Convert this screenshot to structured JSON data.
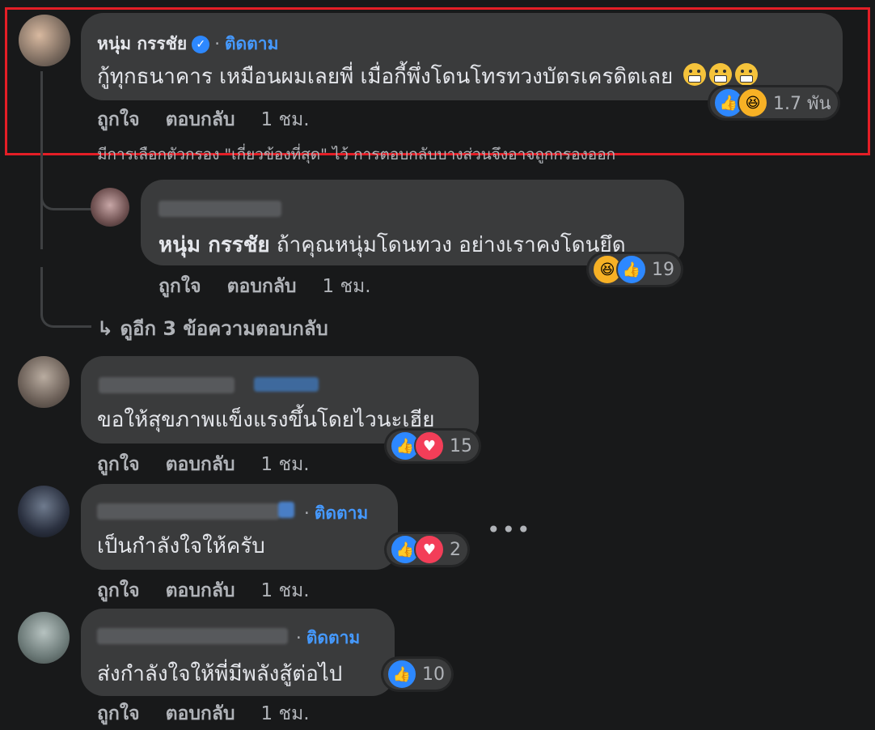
{
  "comments": [
    {
      "author": "หนุ่ม กรรชัย",
      "follow": "ติดตาม",
      "text": "กู้ทุกธนาคาร เหมือนผมเลยพี่ เมื่อกี้พึ่งโดนโทรทวงบัตรเครดิตเลย",
      "like": "ถูกใจ",
      "reply": "ตอบกลับ",
      "time": "1 ชม.",
      "reaction_count": "1.7 พัน",
      "reactions": [
        "like-icon",
        "haha-icon"
      ],
      "note": "มีการเลือกตัวกรอง \"เกี่ยวข้องที่สุด\" ไว้ การตอบกลับบางส่วนจึงอาจถูกกรองออก",
      "emojis": [
        "grimacing-emoji",
        "grimacing-emoji",
        "grimacing-emoji"
      ]
    }
  ],
  "reply": {
    "mention": "หนุ่ม กรรชัย",
    "text": " ถ้าคุณหนุ่มโดนทวง อย่างเราคงโดนยึด",
    "like": "ถูกใจ",
    "reply": "ตอบกลับ",
    "time": "1 ชม.",
    "reaction_count": "19",
    "reactions": [
      "haha-icon",
      "like-icon"
    ]
  },
  "view_more": "↳ ดูอีก 3 ข้อความตอบกลับ",
  "others": [
    {
      "text": "ขอให้สุขภาพแข็งแรงขึ้นโดยไวนะเฮีย",
      "like": "ถูกใจ",
      "reply": "ตอบกลับ",
      "time": "1 ชม.",
      "reaction_count": "15",
      "reactions": [
        "like-icon",
        "love-icon"
      ]
    },
    {
      "follow": "ติดตาม",
      "text": "เป็นกำลังใจให้ครับ",
      "like": "ถูกใจ",
      "reply": "ตอบกลับ",
      "time": "1 ชม.",
      "reaction_count": "2",
      "reactions": [
        "like-icon",
        "love-icon"
      ],
      "more": "•••"
    },
    {
      "follow": "ติดตาม",
      "text": "ส่งกำลังใจให้พี่มีพลังสู้ต่อไป",
      "like": "ถูกใจ",
      "reply": "ตอบกลับ",
      "time": "1 ชม.",
      "reaction_count": "10",
      "reactions": [
        "like-icon"
      ]
    }
  ],
  "colors": {
    "background": "#18191a",
    "bubble": "#3a3b3c",
    "accent": "#4599ff",
    "highlight": "#e41e26"
  }
}
